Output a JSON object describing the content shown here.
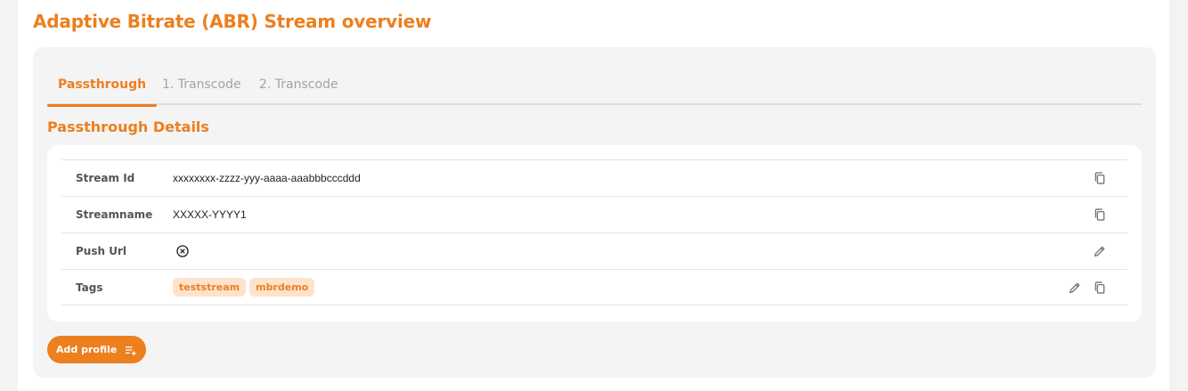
{
  "page": {
    "title": "Adaptive Bitrate (ABR) Stream overview"
  },
  "tabs": [
    {
      "label": "Passthrough",
      "active": true
    },
    {
      "label": "1. Transcode",
      "active": false
    },
    {
      "label": "2. Transcode",
      "active": false
    }
  ],
  "section": {
    "title": "Passthrough Details"
  },
  "details": {
    "stream_id": {
      "label": "Stream Id",
      "value": "xxxxxxxx-zzzz-yyy-aaaa-aaabbbcccddd",
      "action_icon": "copy-icon"
    },
    "streamname": {
      "label": "Streamname",
      "value": "XXXXX-YYYY1",
      "action_icon": "copy-icon"
    },
    "push_url": {
      "label": "Push Url",
      "value_icon": "circle-x-icon",
      "action_icon": "pencil-icon"
    },
    "tags": {
      "label": "Tags",
      "items": [
        "teststream",
        "mbrdemo"
      ],
      "action_icons": [
        "pencil-icon",
        "copy-icon"
      ]
    }
  },
  "add_profile": {
    "label": "Add profile",
    "icon": "playlist-add-icon"
  },
  "colors": {
    "accent": "#ec7f1e",
    "tag_bg": "#fde3cc",
    "card_bg": "#f4f4f4"
  }
}
